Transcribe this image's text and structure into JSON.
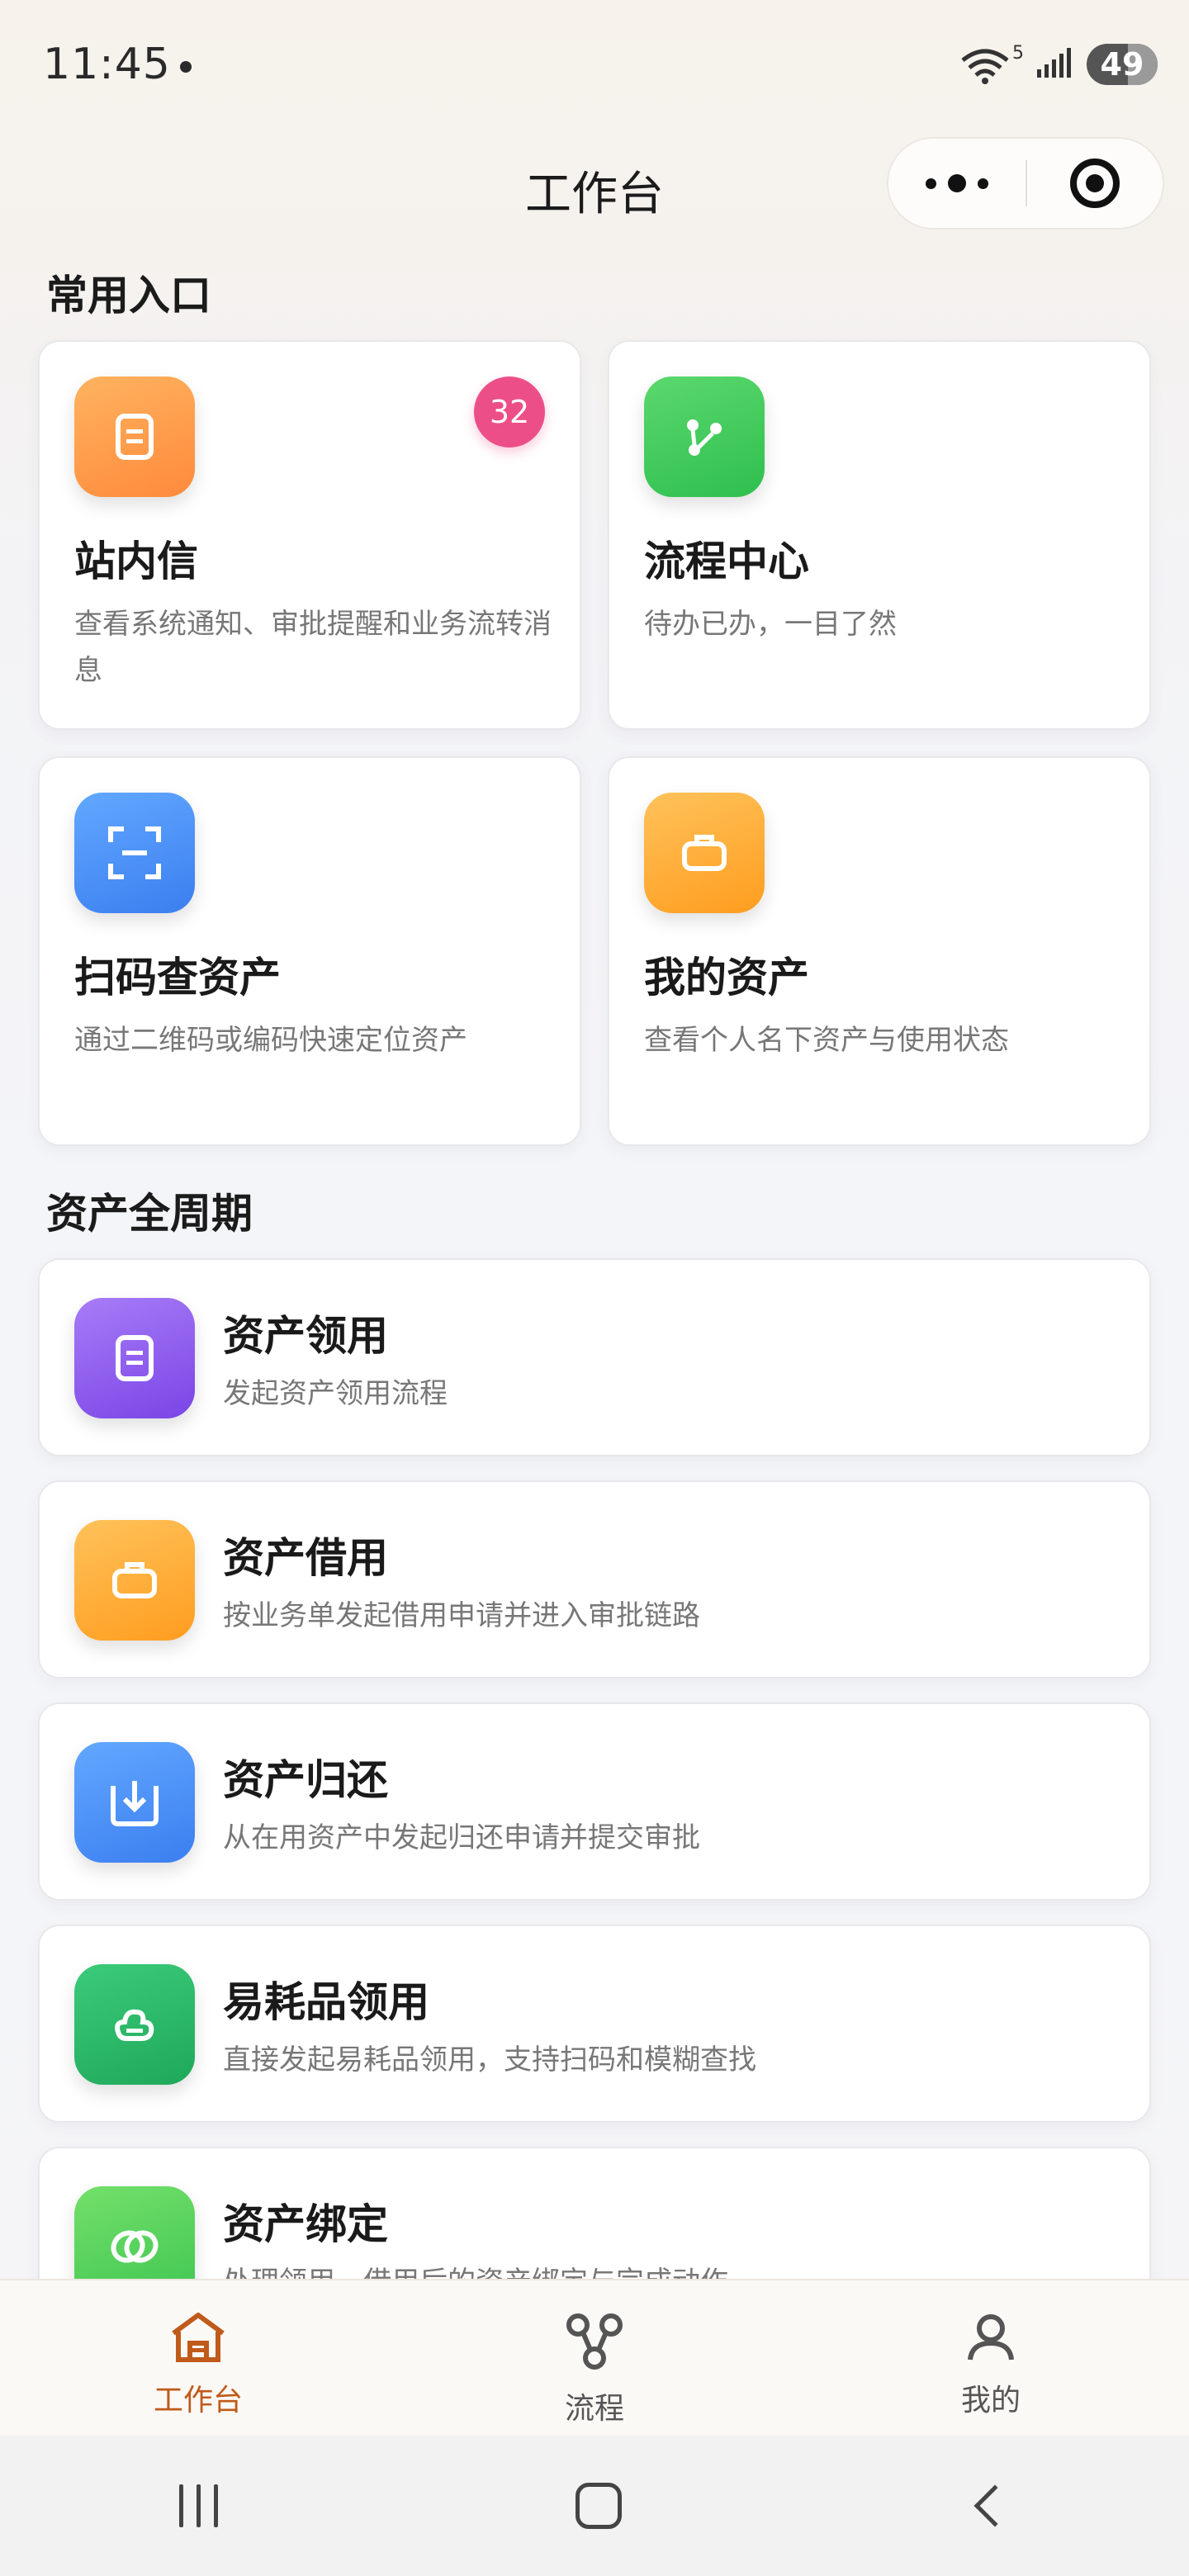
{
  "status_bar": {
    "time": "11:45",
    "signal_label": "5",
    "battery": "49"
  },
  "header": {
    "title": "工作台"
  },
  "quick": {
    "title": "常用入口",
    "items": [
      {
        "title": "站内信",
        "desc": "查看系统通知、审批提醒和业务流转消息",
        "badge": "32",
        "icon": "document-icon",
        "color": "#ff9a45"
      },
      {
        "title": "流程中心",
        "desc": "待办已办，一目了然",
        "icon": "flow-icon",
        "color": "#3fc95a"
      },
      {
        "title": "扫码查资产",
        "desc": "通过二维码或编码快速定位资产",
        "icon": "scan-icon",
        "color": "#4a8ef7"
      },
      {
        "title": "我的资产",
        "desc": "查看个人名下资产与使用状态",
        "icon": "briefcase-icon",
        "color": "#ffab32"
      }
    ]
  },
  "lifecycle": {
    "title": "资产全周期",
    "items": [
      {
        "title": "资产领用",
        "desc": "发起资产领用流程",
        "icon": "document-icon",
        "color": "#8c5cf0"
      },
      {
        "title": "资产借用",
        "desc": "按业务单发起借用申请并进入审批链路",
        "icon": "briefcase-icon",
        "color": "#ffa82c"
      },
      {
        "title": "资产归还",
        "desc": "从在用资产中发起归还申请并提交审批",
        "icon": "return-icon",
        "color": "#4a8ef7"
      },
      {
        "title": "易耗品领用",
        "desc": "直接发起易耗品领用，支持扫码和模糊查找",
        "icon": "consumable-icon",
        "color": "#26b566"
      },
      {
        "title": "资产绑定",
        "desc": "处理领用、借用后的资产绑定与完成动作",
        "icon": "link-icon",
        "color": "#52d060"
      }
    ]
  },
  "tabbar": {
    "tabs": [
      {
        "label": "工作台",
        "icon": "home-icon",
        "active": true
      },
      {
        "label": "流程",
        "icon": "process-icon",
        "active": false
      },
      {
        "label": "我的",
        "icon": "user-icon",
        "active": false
      }
    ],
    "active_color": "#c05a1a"
  }
}
